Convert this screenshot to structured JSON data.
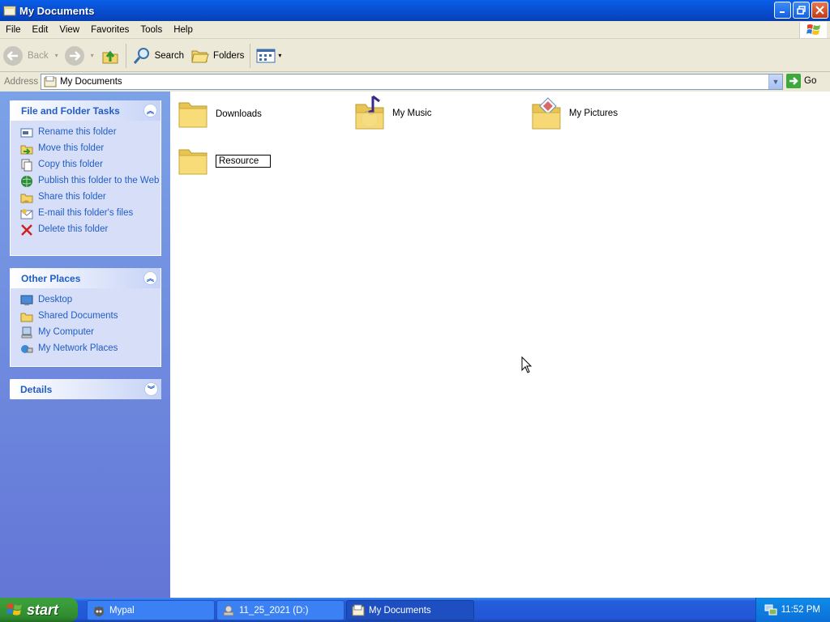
{
  "window": {
    "title": "My Documents"
  },
  "menubar": {
    "items": [
      "File",
      "Edit",
      "View",
      "Favorites",
      "Tools",
      "Help"
    ]
  },
  "toolbar": {
    "back": "Back",
    "search": "Search",
    "folders": "Folders"
  },
  "address": {
    "label": "Address",
    "value": "My Documents",
    "go": "Go"
  },
  "sidebar": {
    "file_tasks": {
      "title": "File and Folder Tasks",
      "items": [
        "Rename this folder",
        "Move this folder",
        "Copy this folder",
        "Publish this folder to the Web",
        "Share this folder",
        "E-mail this folder's files",
        "Delete this folder"
      ]
    },
    "other_places": {
      "title": "Other Places",
      "items": [
        "Desktop",
        "Shared Documents",
        "My Computer",
        "My Network Places"
      ]
    },
    "details": {
      "title": "Details"
    }
  },
  "content": {
    "items": [
      "Downloads",
      "My Music",
      "My Pictures"
    ],
    "renaming_item": "Resource"
  },
  "taskbar": {
    "start": "start",
    "tasks": [
      "Mypal",
      "11_25_2021 (D:)",
      "My Documents"
    ],
    "clock": "11:52 PM"
  },
  "colors": {
    "titlebar": "#0A5FEA",
    "link": "#215DC6",
    "sidebar": "#7BA2E7",
    "taskbar": "#245DDB",
    "start": "#3A9E3A"
  }
}
